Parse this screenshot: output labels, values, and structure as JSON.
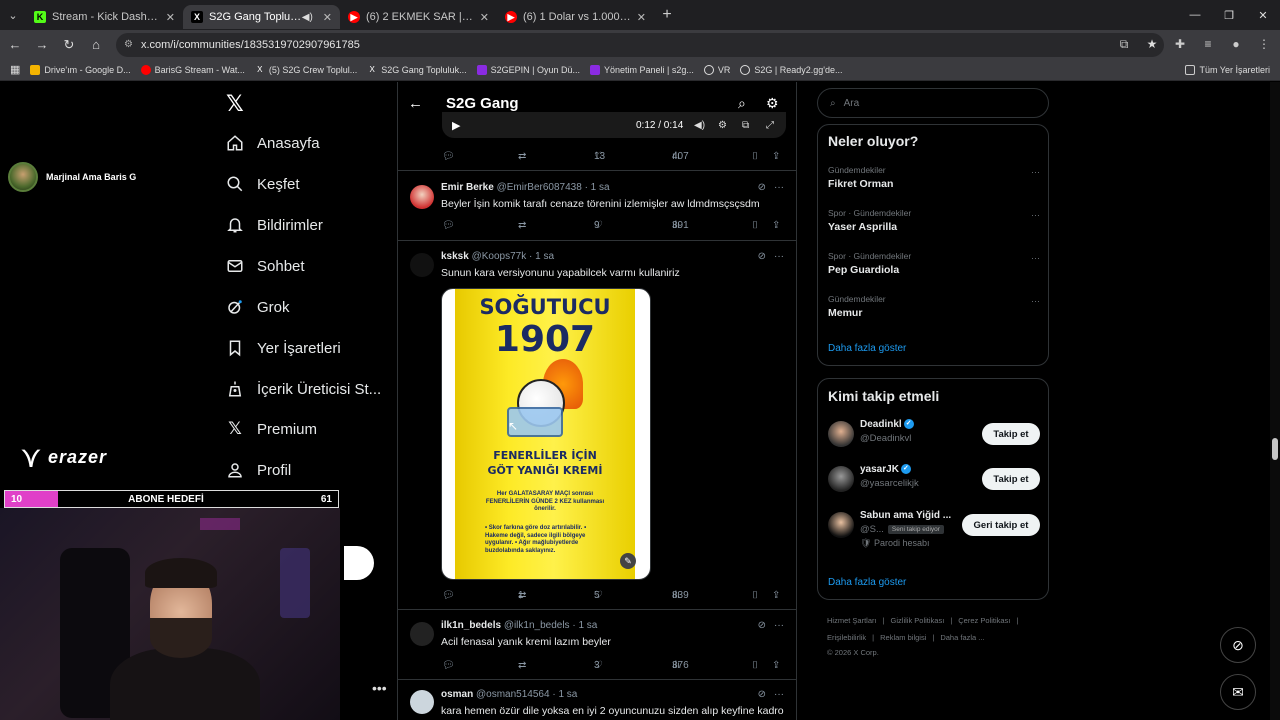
{
  "browser": {
    "tabs": [
      {
        "title": "Stream - Kick Dashboard",
        "fav": "K",
        "color": "#53fc18"
      },
      {
        "title": "S2G Gang Topluluk / X",
        "fav": "X",
        "color": "#000000",
        "active": true
      },
      {
        "title": "(6) 2 EKMEK SAR | Madara Old...",
        "fav": "▶",
        "color": "#ff0000"
      },
      {
        "title": "(6) 1 Dolar vs 1.000.000.000 Do...",
        "fav": "▶",
        "color": "#ff0000"
      }
    ],
    "url": "x.com/i/communities/1835319702907961785",
    "bookmarks": [
      {
        "label": "Drive'ım - Google D...",
        "icon": "drive-icon"
      },
      {
        "label": "BarisG Stream - Wat...",
        "icon": "youtube-icon"
      },
      {
        "label": "(5) S2G Crew Toplul...",
        "icon": "x-icon"
      },
      {
        "label": "S2G Gang Topluluk...",
        "icon": "x-icon"
      },
      {
        "label": "S2GEPIN | Oyun Dü...",
        "icon": "s2g-icon"
      },
      {
        "label": "Yönetim Paneli | s2g...",
        "icon": "s2g-icon"
      },
      {
        "label": "VR",
        "icon": "vr-icon"
      },
      {
        "label": "S2G | Ready2.gg'de...",
        "icon": "s2g-icon"
      }
    ],
    "all_bookmarks": "Tüm Yer İşaretleri"
  },
  "overlay": {
    "streamer_name": "Marjinal Ama Baris G",
    "brand": "erazer",
    "goal_left": "10",
    "goal_label": "ABONE HEDEFİ",
    "goal_right": "61",
    "goal_progress": 0.16
  },
  "nav": {
    "items": [
      "Anasayfa",
      "Keşfet",
      "Bildirimler",
      "Sohbet",
      "Grok",
      "Yer İşaretleri",
      "İçerik Üreticisi St...",
      "Premium",
      "Profil"
    ]
  },
  "feed": {
    "title": "S2G Gang",
    "video_time": "0:12 / 0:14",
    "top_actions": {
      "retweets": "",
      "likes": "13",
      "views": "407"
    },
    "tweets": [
      {
        "name": "Emir Berke",
        "handle": "@EmirBer6087438",
        "time": "· 1 sa",
        "text": "Beyler İşin komik tarafı cenaze törenini izlemişler aw ldmdmsçsçsdm",
        "replies": "",
        "retweets": "",
        "likes": "9",
        "views": "391"
      },
      {
        "name": "ksksk",
        "handle": "@Koops77k",
        "time": "· 1 sa",
        "text": "Sunun kara versiyonunu yapabilcek varmı kullaniriz",
        "replies": "",
        "retweets": "1",
        "likes": "5",
        "views": "839"
      },
      {
        "name": "ilk1n_bedels",
        "handle": "@ilk1n_bedels",
        "time": "· 1 sa",
        "text": "Acil fenasal yanık kremi lazım beyler",
        "replies": "",
        "retweets": "",
        "likes": "3",
        "views": "376"
      },
      {
        "name": "osman",
        "handle": "@osman514564",
        "time": "· 1 sa",
        "text": "kara hemen özür dile yoksa en iyi 2 oyuncunuzu sizden alıp keyfine kadro"
      }
    ],
    "meme": {
      "line1": "SOĞUTUCU",
      "line2": "1907",
      "line3": "FENERLİLER İÇİN",
      "line4": "GÖT YANIĞI KREMİ",
      "small1": "Her GALATASARAY MAÇI sonrası FENERLİLERİN GÜNDE 2 KEZ kullanması önerilir.",
      "small2": "• Skor farkına göre doz artırılabilir. • Hakeme değil, sadece ilgili bölgeye uygulanır. • Ağır mağlubiyetlerde buzdolabında saklayınız."
    }
  },
  "right": {
    "search_placeholder": "Ara",
    "trends_title": "Neler oluyor?",
    "trends": [
      {
        "cat": "Gündemdekiler",
        "name": "Fikret Orman"
      },
      {
        "cat": "Spor · Gündemdekiler",
        "name": "Yaser Asprilla"
      },
      {
        "cat": "Spor · Gündemdekiler",
        "name": "Pep Guardiola"
      },
      {
        "cat": "Gündemdekiler",
        "name": "Memur"
      }
    ],
    "show_more": "Daha fazla göster",
    "follow_title": "Kimi takip etmeli",
    "follows": [
      {
        "name": "Deadinkl",
        "handle": "@Deadinkvl",
        "btn": "Takip et"
      },
      {
        "name": "yasarJK",
        "handle": "@yasarcelikjk",
        "btn": "Takip et"
      },
      {
        "name": "Sabun ama Yiğid ...",
        "handle": "@S...",
        "followsyou": "Seni takip ediyor",
        "parody": "Parodi hesabı",
        "btn": "Geri takip et"
      }
    ],
    "footer1": [
      "Hizmet Şartları",
      "|",
      "Gizlilik Politikası",
      "|",
      "Çerez Politikası",
      "|"
    ],
    "footer2": [
      "Erişilebilirlik",
      "|",
      "Reklam bilgisi",
      "|",
      "Daha fazla ..."
    ],
    "copyright": "© 2026 X Corp."
  }
}
